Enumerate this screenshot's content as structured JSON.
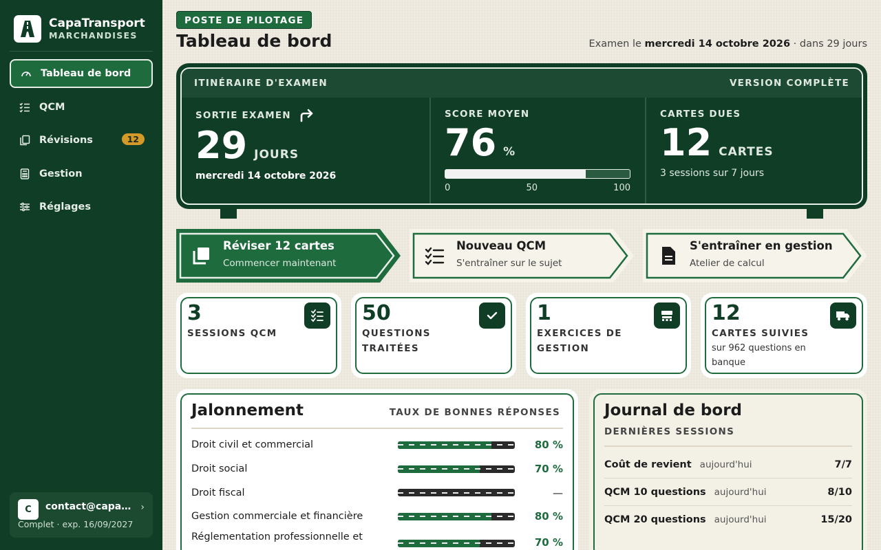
{
  "brand": {
    "name": "CapaTransport",
    "subtitle": "MARCHANDISES"
  },
  "nav": {
    "items": [
      {
        "label": "Tableau de bord",
        "icon": "gauge-icon",
        "active": true
      },
      {
        "label": "QCM",
        "icon": "list-check-icon"
      },
      {
        "label": "Révisions",
        "icon": "cards-icon",
        "badge": "12"
      },
      {
        "label": "Gestion",
        "icon": "calculator-icon"
      },
      {
        "label": "Réglages",
        "icon": "sliders-icon"
      }
    ]
  },
  "account": {
    "avatar": "C",
    "email": "contact@capatransport.fr",
    "plan": "Complet · exp. 16/09/2027"
  },
  "header": {
    "kicker": "POSTE DE PILOTAGE",
    "title": "Tableau de bord",
    "exam_prefix": "Examen le ",
    "exam_date": "mercredi 14 octobre 2026",
    "exam_suffix": " · dans 29 jours"
  },
  "sign": {
    "title": "ITINÉRAIRE D'EXAMEN",
    "version": "VERSION COMPLÈTE",
    "exam": {
      "label": "SORTIE EXAMEN",
      "value": "29",
      "unit": "JOURS",
      "sub": "mercredi 14 octobre 2026"
    },
    "score": {
      "label": "SCORE MOYEN",
      "value": "76",
      "unit": "%",
      "progress": 76,
      "ticks": [
        "0",
        "50",
        "100"
      ]
    },
    "cards": {
      "label": "CARTES DUES",
      "value": "12",
      "unit": "CARTES",
      "sub": "3 sessions sur 7 jours"
    }
  },
  "actions": [
    {
      "title": "Réviser 12 cartes",
      "sub": "Commencer maintenant",
      "icon": "cards-icon",
      "primary": true
    },
    {
      "title": "Nouveau QCM",
      "sub": "S'entraîner sur le sujet",
      "icon": "list-check-icon"
    },
    {
      "title": "S'entraîner en gestion",
      "sub": "Atelier de calcul",
      "icon": "document-icon"
    }
  ],
  "stats": [
    {
      "value": "3",
      "label": "SESSIONS QCM",
      "icon": "list-check-icon"
    },
    {
      "value": "50",
      "label": "QUESTIONS TRAITÉES",
      "icon": "check-icon"
    },
    {
      "value": "1",
      "label": "EXERCICES DE GESTION",
      "icon": "cash-register-icon"
    },
    {
      "value": "12",
      "label": "CARTES SUIVIES",
      "extra": "sur 962 questions en banque",
      "icon": "truck-icon"
    }
  ],
  "jalonnement": {
    "title": "Jalonnement",
    "hint": "TAUX DE BONNES RÉPONSES",
    "rows": [
      {
        "label": "Droit civil et commercial",
        "value": "80 %",
        "pct": 80
      },
      {
        "label": "Droit social",
        "value": "70 %",
        "pct": 70
      },
      {
        "label": "Droit fiscal",
        "value": "—",
        "pct": 0
      },
      {
        "label": "Gestion commerciale et financière",
        "value": "80 %",
        "pct": 80
      },
      {
        "label": "Réglementation professionnelle et",
        "value": "70 %",
        "pct": 70
      }
    ]
  },
  "journal": {
    "title": "Journal de bord",
    "subtitle": "DERNIÈRES SESSIONS",
    "rows": [
      {
        "name": "Coût de revient",
        "when": "aujourd'hui",
        "score": "7/7"
      },
      {
        "name": "QCM 10 questions",
        "when": "aujourd'hui",
        "score": "8/10"
      },
      {
        "name": "QCM 20 questions",
        "when": "aujourd'hui",
        "score": "15/20"
      }
    ]
  },
  "colors": {
    "forest": "#0f3d26",
    "green": "#1e6b3d",
    "badge": "#d39a2a",
    "paper": "#efebe0"
  }
}
